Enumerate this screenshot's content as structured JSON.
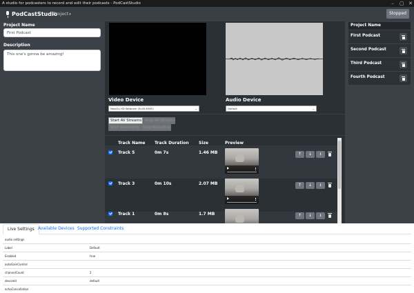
{
  "window": {
    "title": "A studio for podcasters to record and edit their podcasts - PodCastStudio"
  },
  "navbar": {
    "brand": "PodCastStudio",
    "project_menu": "Project",
    "status_button": "Stopped"
  },
  "left_panel": {
    "name_label": "Project Name",
    "name_value": "First Podcast",
    "description_label": "Description",
    "description_value": "This one's gonna be amazing!"
  },
  "devices": {
    "video_label": "Video Device",
    "video_selected": "NexiGo HD Webcam (5c45:6365)",
    "audio_label": "Audio Device",
    "audio_selected": "Default",
    "start_button": "Start AV Streams",
    "disabled_buttons": [
      "Stop AV Streams",
      "Start Recording",
      "Stop Recording"
    ]
  },
  "tracks": {
    "columns": [
      "Track Name",
      "Track Duration",
      "Size",
      "Preview"
    ],
    "rows": [
      {
        "name": "Track 5",
        "duration": "0m 7s",
        "size": "1.46 MB",
        "checked": true
      },
      {
        "name": "Track 3",
        "duration": "0m 10s",
        "size": "2.07 MB",
        "checked": true
      },
      {
        "name": "Track 1",
        "duration": "0m 8s",
        "size": "1.7 MB",
        "checked": true
      }
    ],
    "action_icons": [
      "arrow-up-icon",
      "arrow-down-icon",
      "download-icon",
      "trash-icon"
    ]
  },
  "projects": {
    "header": "Project Name",
    "items": [
      "First Podcast",
      "Second Podcast",
      "Third Podcast",
      "Fourth Podcast"
    ]
  },
  "bottom_tabs": {
    "tabs": [
      "Live Settings",
      "Available Devices",
      "Supported Constraints"
    ],
    "active": "Live Settings"
  },
  "settings": {
    "rows": [
      {
        "key": "audio settings",
        "value": ""
      },
      {
        "key": "Label",
        "value": "Default"
      },
      {
        "key": "Enabled",
        "value": "true"
      },
      {
        "key": "autoGainControl",
        "value": ""
      },
      {
        "key": "channelCount",
        "value": "2"
      },
      {
        "key": "deviceId",
        "value": "default"
      },
      {
        "key": "echoCancellation",
        "value": ""
      }
    ]
  },
  "colors": {
    "navbar": "#3a3f45",
    "sidebar": "#3c4148",
    "center": "#2b3035",
    "accent": "#0d6efd",
    "secondary": "#6c757d"
  }
}
